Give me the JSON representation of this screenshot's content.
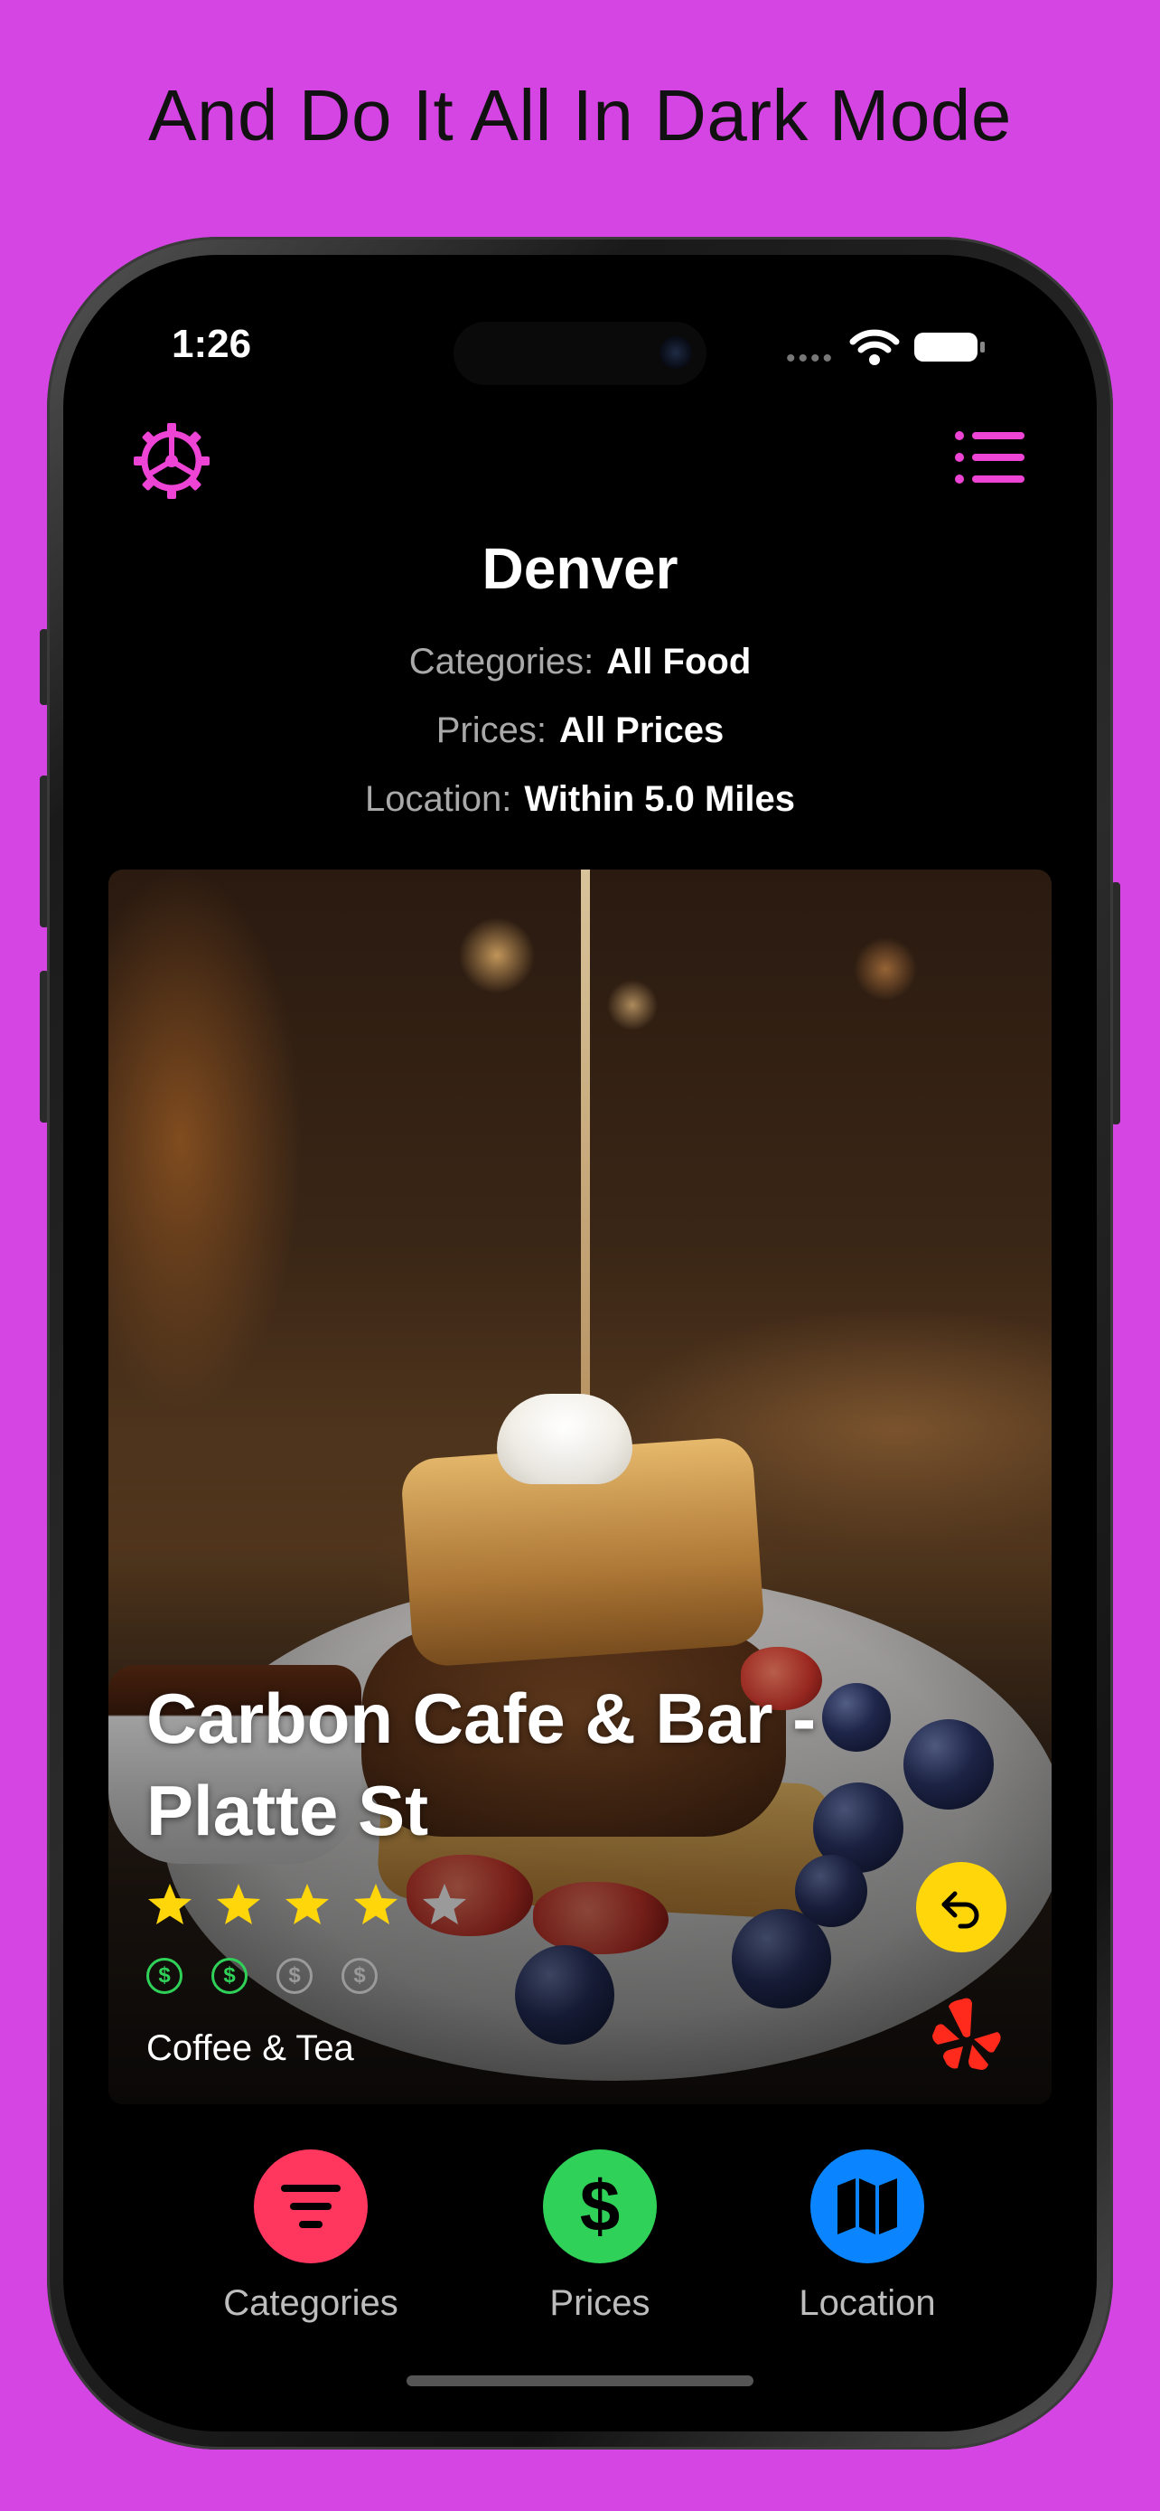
{
  "headline": "And Do It All In Dark Mode",
  "status_bar": {
    "time": "1:26"
  },
  "header": {
    "settings_icon": "gear-icon",
    "list_icon": "list-icon",
    "city": "Denver"
  },
  "filters": {
    "categories": {
      "label": "Categories:",
      "value": "All Food"
    },
    "prices": {
      "label": "Prices:",
      "value": "All Prices"
    },
    "location": {
      "label": "Location:",
      "value": "Within 5.0 Miles"
    }
  },
  "card": {
    "title": "Carbon Cafe & Bar - Platte St",
    "rating": 4,
    "rating_max": 5,
    "price_level": 2,
    "price_max": 4,
    "price_symbol": "$",
    "category": "Coffee & Tea",
    "undo_icon": "undo-icon",
    "source_icon": "yelp-icon"
  },
  "tabs": [
    {
      "label": "Categories",
      "icon": "filter-lines-icon",
      "color": "#ff375f"
    },
    {
      "label": "Prices",
      "icon": "dollar-icon",
      "color": "#30d158"
    },
    {
      "label": "Location",
      "icon": "map-icon",
      "color": "#0a84ff"
    }
  ],
  "colors": {
    "background": "#d545e3",
    "accent": "#ee44d6",
    "star": "#ffd60a",
    "undo": "#ffd60a",
    "yelp": "#ff2a1c"
  }
}
